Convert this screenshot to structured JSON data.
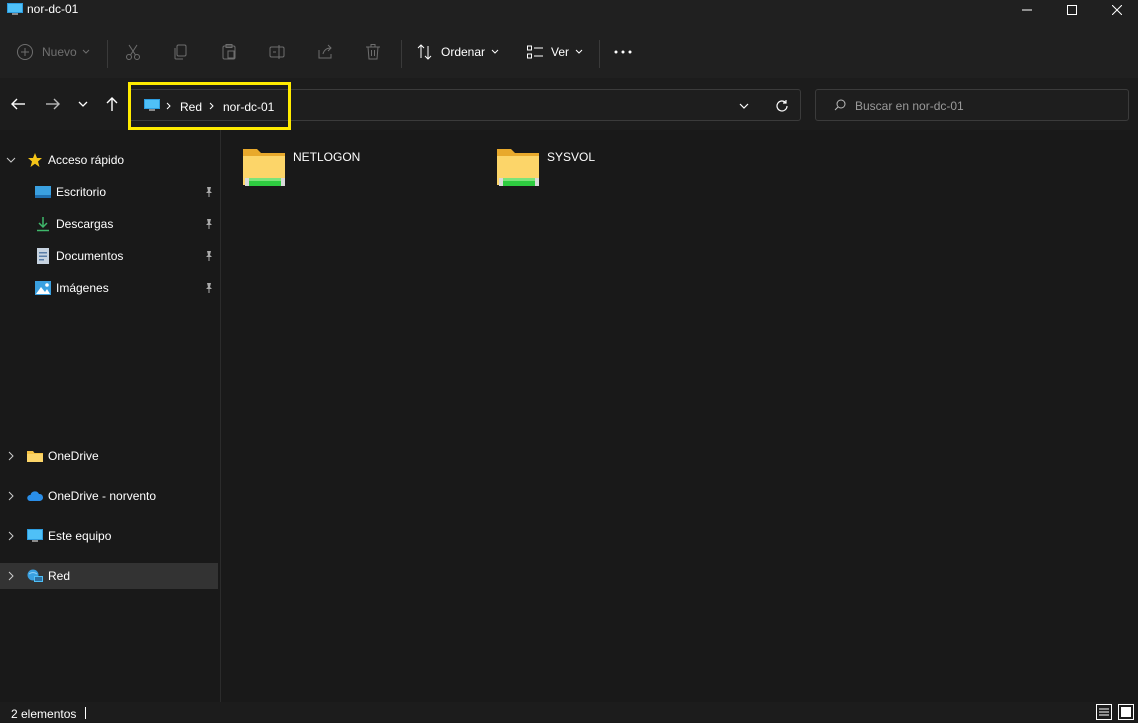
{
  "window": {
    "title": "nor-dc-01"
  },
  "toolbar": {
    "new_label": "Nuevo",
    "sort_label": "Ordenar",
    "view_label": "Ver"
  },
  "address": {
    "crumbs": [
      "Red",
      "nor-dc-01"
    ]
  },
  "search": {
    "placeholder": "Buscar en nor-dc-01"
  },
  "sidebar": {
    "quick_access": {
      "label": "Acceso rápido",
      "items": [
        {
          "label": "Escritorio",
          "icon": "desktop-icon"
        },
        {
          "label": "Descargas",
          "icon": "download-icon"
        },
        {
          "label": "Documentos",
          "icon": "document-icon"
        },
        {
          "label": "Imágenes",
          "icon": "pictures-icon"
        }
      ]
    },
    "roots": [
      {
        "label": "OneDrive",
        "icon": "folder-icon"
      },
      {
        "label": "OneDrive - norvento",
        "icon": "cloud-icon"
      },
      {
        "label": "Este equipo",
        "icon": "computer-icon"
      },
      {
        "label": "Red",
        "icon": "network-icon",
        "selected": true
      }
    ]
  },
  "files": [
    {
      "name": "NETLOGON",
      "icon": "shared-folder-icon"
    },
    {
      "name": "SYSVOL",
      "icon": "shared-folder-icon"
    }
  ],
  "status": {
    "count_label": "2 elementos"
  },
  "colors": {
    "highlight": "#ffeb00",
    "selection": "#333333",
    "folder": "#f6c344",
    "share": "#2ecc40"
  }
}
